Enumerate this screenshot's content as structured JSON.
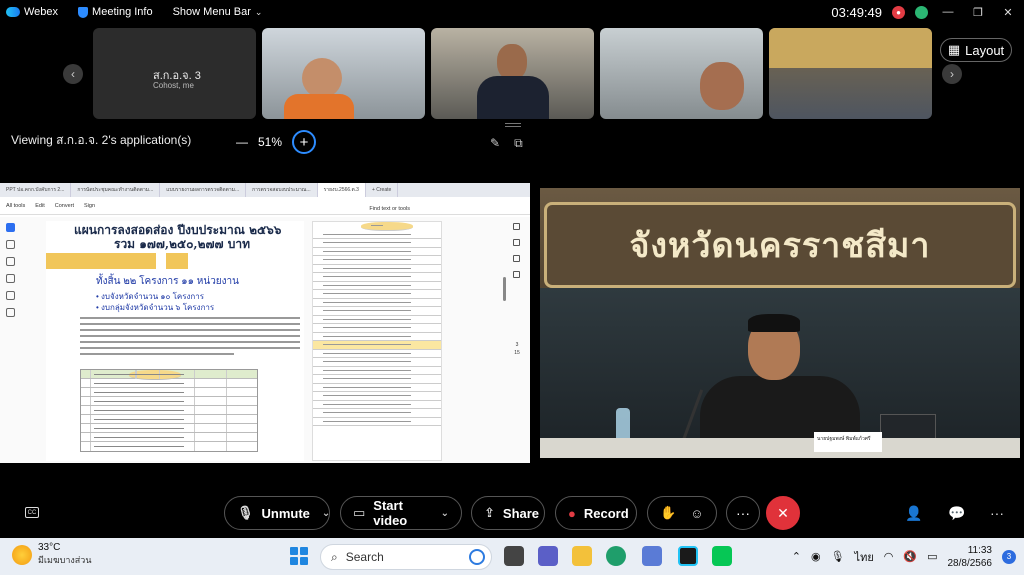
{
  "titlebar": {
    "app_name": "Webex",
    "meeting_info": "Meeting Info",
    "show_menu_bar": "Show Menu Bar",
    "time": "03:49:49"
  },
  "participants": [
    {
      "name": "ส.ก.อ.จ. 3",
      "sub": "Cohost, me"
    }
  ],
  "layout_label": "Layout",
  "viewing": {
    "label": "Viewing ส.ก.อ.จ. 2's application(s)",
    "zoom": "51%"
  },
  "doc": {
    "tabs": [
      "PPT ปอ.คกก.บังคับการ 2...",
      "การนัดประชุมคณะทำงานติดตาม...",
      "แบบรายงานผลการตรวจติดตาม...",
      "การตรวจสอบงบประมาณ...",
      "รายงบ.2566.ต.3",
      "+ Create"
    ],
    "menu": [
      "All tools",
      "Edit",
      "Convert",
      "Sign"
    ],
    "find": "Find text or tools",
    "title_line1": "แผนการลงสอดส่อง ปีงบประมาณ ๒๕๖๖",
    "title_line2": "รวม ๑๗๗,๒๕๐,๒๗๗ บาท",
    "subtitle": "ทั้งสิ้น ๒๒ โครงการ ๑๑ หน่วยงาน",
    "bullet1": "• งบจังหวัดจำนวน ๑๐ โครงการ",
    "bullet2": "• งบกลุ่มจังหวัดจำนวน ๖ โครงการ",
    "page_numbers": "3\n15"
  },
  "video": {
    "sign": "จังหวัดนครราชสีมา",
    "nameplate": "นายปฐมพงษ์ พิมพ์แก้วศรี"
  },
  "controls": {
    "unmute": "Unmute",
    "start_video": "Start video",
    "share": "Share",
    "record": "Record"
  },
  "taskbar": {
    "temp": "33°C",
    "weather": "มีเมฆบางส่วน",
    "search": "Search",
    "lang": "ไทย",
    "time": "11:33",
    "date": "28/8/2566",
    "notifications": "3"
  },
  "colors": {
    "accent": "#2d8cff",
    "record_red": "#e23c44",
    "end_red": "#e0323a",
    "highlight": "#f1c65a"
  }
}
